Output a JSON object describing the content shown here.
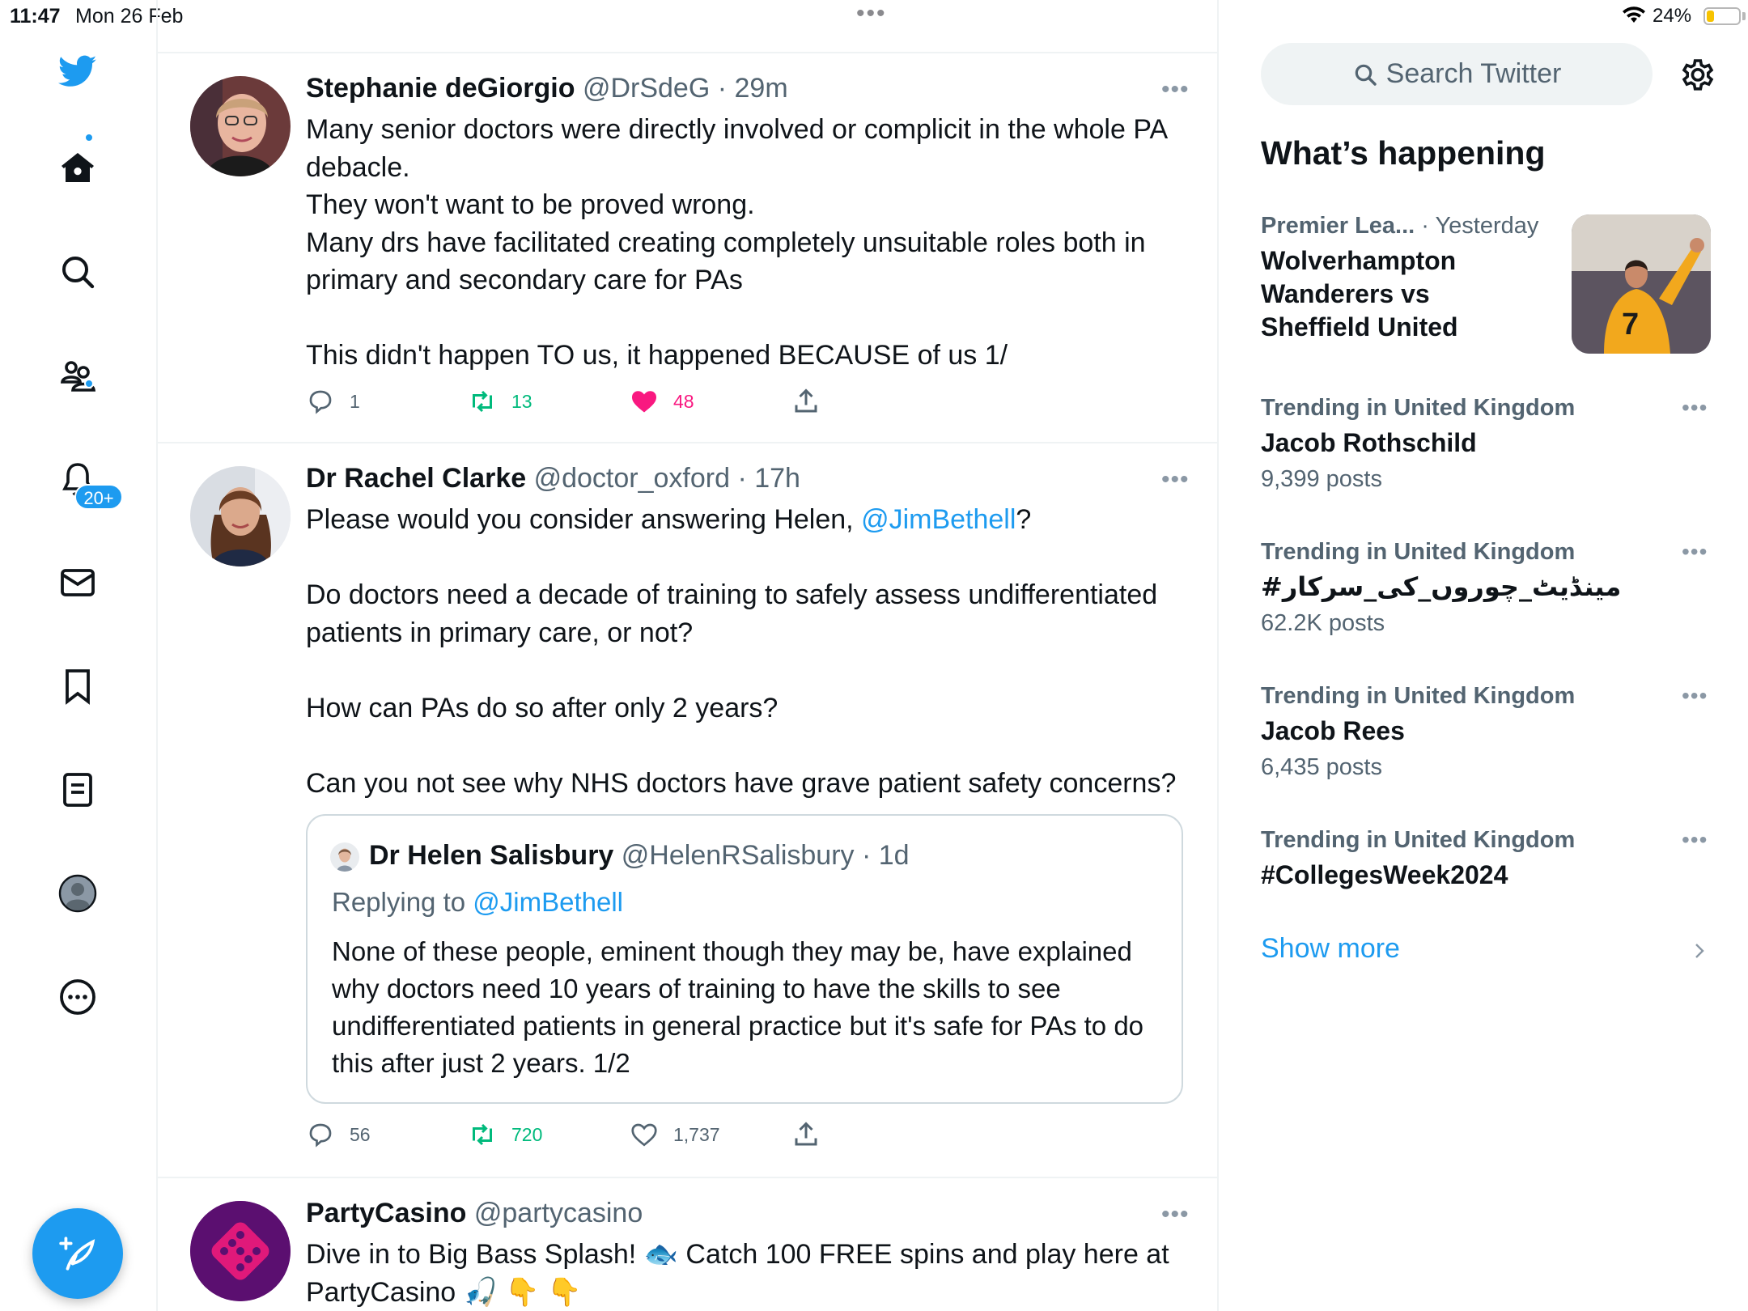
{
  "status_bar": {
    "time": "11:47",
    "date": "Mon 26 Feb",
    "battery_pct": "24%",
    "battery_level": 0.24,
    "battery_color": "#f7c300"
  },
  "nav": {
    "icons": [
      "twitter-bird-icon",
      "home-icon",
      "search-icon",
      "communities-icon",
      "notifications-icon",
      "messages-icon",
      "bookmarks-icon",
      "lists-icon",
      "profile-icon",
      "more-icon"
    ],
    "notifications_badge": "20+",
    "compose_icon": "compose-feather-icon",
    "accent": "#1d9bf0"
  },
  "tweets": [
    {
      "name": "Stephanie deGiorgio",
      "handle": "@DrSdeG",
      "sep": " · ",
      "time": "29m",
      "text": "Many senior doctors were directly involved or complicit in the whole PA debacle.\nThey won't want to be proved wrong.\nMany drs have facilitated creating completely unsuitable roles both in primary and secondary care for PAs\n\nThis didn't happen TO us, it happened BECAUSE of us 1/",
      "replies": "1",
      "retweets": "13",
      "likes": "48"
    },
    {
      "name": "Dr Rachel Clarke",
      "handle": "@doctor_oxford",
      "sep": " · ",
      "time": "17h",
      "text_a": "Please would you consider answering Helen, ",
      "mention": "@JimBethell",
      "text_b": "?\n\nDo doctors need a decade of training to safely assess undifferentiated patients in primary care, or not?\n\nHow can PAs do so after only 2 years?\n\nCan you not see why NHS doctors have grave patient safety concerns?",
      "quote": {
        "name": "Dr Helen Salisbury",
        "handle": "@HelenRSalisbury",
        "sep": " · ",
        "time": "1d",
        "replying_label": "Replying to ",
        "replying_to": "@JimBethell",
        "text": "None of these people, eminent though they may be, have explained why doctors need 10 years of training to have the skills to see undifferentiated patients in general practice but it's safe for PAs to do this after just 2 years. 1/2"
      },
      "replies": "56",
      "retweets": "720",
      "likes": "1,737"
    },
    {
      "name": "PartyCasino",
      "handle": "@partycasino",
      "text": "Dive in to Big Bass Splash! 🐟 Catch 100 FREE spins and play here at PartyCasino 🎣 👇 👇"
    }
  ],
  "sidebar": {
    "search_placeholder": "Search Twitter",
    "section_title": "What’s happening",
    "featured": {
      "category": "Premier Lea...",
      "time": " · Yesterday",
      "title": "Wolverhampton Wanderers vs Sheffield United"
    },
    "trends": [
      {
        "meta": "Trending in United Kingdom",
        "title": "Jacob Rothschild",
        "count": "9,399 posts"
      },
      {
        "meta": "Trending in United Kingdom",
        "title": "#مینڈیٹ_چوروں_کی_سرکار",
        "count": "62.2K posts"
      },
      {
        "meta": "Trending in United Kingdom",
        "title": "Jacob Rees",
        "count": "6,435 posts"
      },
      {
        "meta": "Trending in United Kingdom",
        "title": "#CollegesWeek2024",
        "count": ""
      }
    ],
    "show_more": "Show more"
  }
}
